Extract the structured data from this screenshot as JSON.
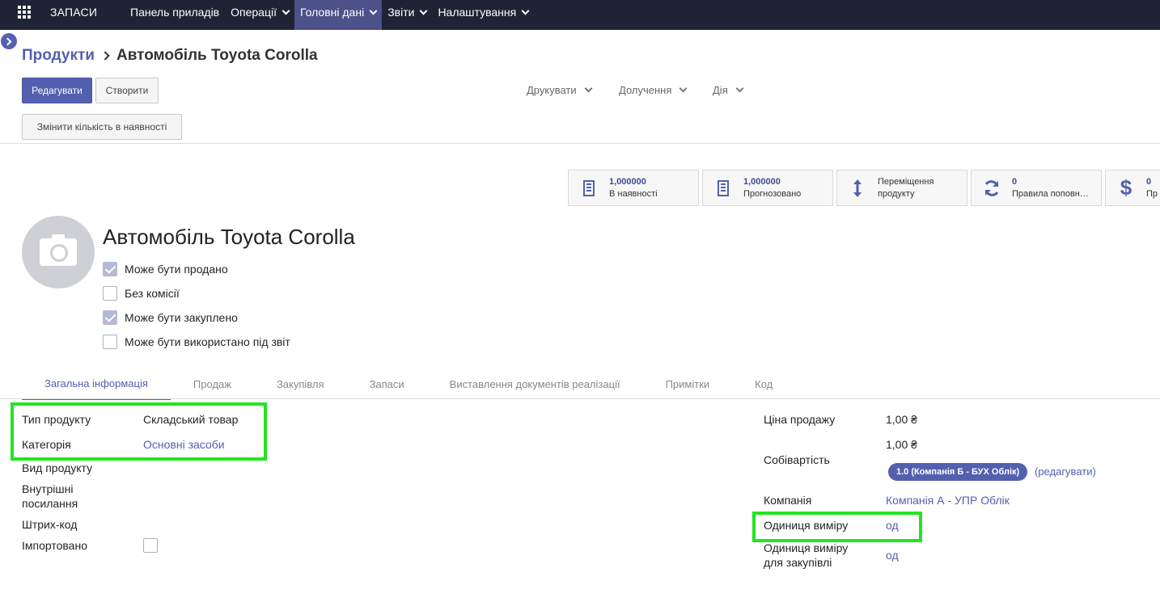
{
  "nav": {
    "app_name": "ЗАПАСИ",
    "menu": [
      {
        "label": "Панель приладів"
      },
      {
        "label": "Операції"
      },
      {
        "label": "Головні дані"
      },
      {
        "label": "Звіти"
      },
      {
        "label": "Налаштування"
      }
    ]
  },
  "breadcrumb": {
    "parent": "Продукти",
    "current": "Автомобіль Toyota Corolla"
  },
  "toolbar": {
    "edit_label": "Редагувати",
    "create_label": "Створити",
    "print_label": "Друкувати",
    "attachments_label": "Долучення",
    "action_label": "Дія",
    "update_qty_label": "Змінити кількість в наявності"
  },
  "smart_buttons": [
    {
      "value": "1,000000",
      "label": "В наявності",
      "icon": "building-icon"
    },
    {
      "value": "1,000000",
      "label": "Прогнозовано",
      "icon": "building-icon"
    },
    {
      "line1": "Переміщення",
      "line2": "продукту",
      "icon": "arrows-vertical-icon"
    },
    {
      "value": "0",
      "label": "Правила поповн…",
      "icon": "refresh-icon"
    },
    {
      "value": "0",
      "label": "Пр",
      "icon": "dollar-icon"
    }
  ],
  "product": {
    "name": "Автомобіль Toyota Corolla",
    "options": [
      {
        "label": "Може бути продано",
        "checked": true
      },
      {
        "label": "Без комісії",
        "checked": false
      },
      {
        "label": "Може бути закуплено",
        "checked": true
      },
      {
        "label": "Може бути використано під звіт",
        "checked": false
      }
    ]
  },
  "tabs": [
    {
      "label": "Загальна інформація",
      "active": true
    },
    {
      "label": "Продаж"
    },
    {
      "label": "Закупівля"
    },
    {
      "label": "Запаси"
    },
    {
      "label": "Виставлення документів реалізації"
    },
    {
      "label": "Примітки"
    },
    {
      "label": "Код"
    }
  ],
  "general": {
    "product_type_label": "Тип продукту",
    "product_type_value": "Складський товар",
    "category_label": "Категорія",
    "category_value": "Основні засоби",
    "kind_label": "Вид продукту",
    "internal_ref_label_1": "Внутрішні",
    "internal_ref_label_2": "посилання",
    "barcode_label": "Штрих-код",
    "imported_label": "Імпортовано",
    "sale_price_label": "Ціна продажу",
    "sale_price_value": "1,00 ₴",
    "cost_label": "Собівартість",
    "cost_value": "1,00 ₴",
    "pricelist_badge": "1.0 (Компанія Б - БУХ Облік)",
    "edit_link": "(редагувати)",
    "company_label": "Компанія",
    "company_value": "Компанія А - УПР Облік",
    "uom_label": "Одиниця виміру",
    "uom_value": "од",
    "purchase_uom_label_1": "Одиниця виміру",
    "purchase_uom_label_2": "для закупівлі",
    "purchase_uom_value": "од"
  },
  "colors": {
    "accent": "#5360b0",
    "navbar": "#1f2336",
    "highlight": "#22e51f"
  }
}
